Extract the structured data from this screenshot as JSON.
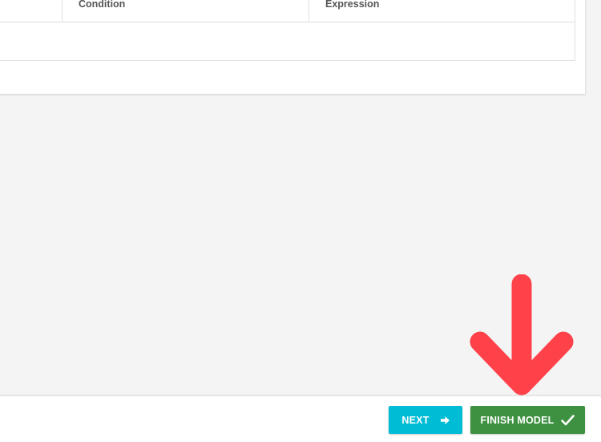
{
  "table": {
    "columns": [
      {
        "label": "Condition"
      },
      {
        "label": "Expression"
      }
    ]
  },
  "footer": {
    "next_label": "NEXT",
    "finish_label": "FINISH MODEL"
  },
  "icons": {
    "next": "arrow-right-icon",
    "finish": "checkmark-icon",
    "annotation": "down-arrow-annotation"
  },
  "colors": {
    "next_button": "#00bcd4",
    "finish_button": "#3d9140",
    "annotation_arrow": "#ff424a"
  }
}
